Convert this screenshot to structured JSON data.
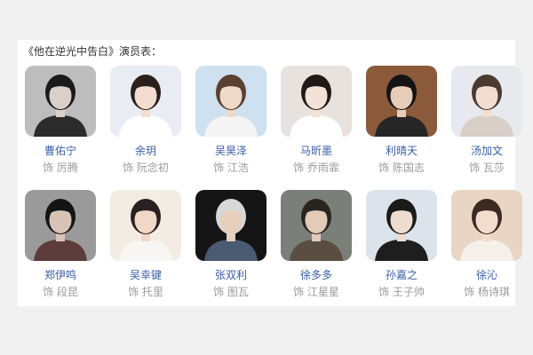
{
  "header": {
    "title": "《他在逆光中告白》演员表："
  },
  "cast": [
    {
      "actor": "曹佑宁",
      "role": "饰 厉腾",
      "bg": "#bdbdbd",
      "shirt": "#2b2b2b",
      "hair": "#1a1a1a",
      "skin": "#d9d0ca"
    },
    {
      "actor": "余玥",
      "role": "饰 阮念初",
      "bg": "#e9edf3",
      "shirt": "#ffffff",
      "hair": "#2a1f1a",
      "skin": "#f2ddd0"
    },
    {
      "actor": "吴昊泽",
      "role": "饰 江浩",
      "bg": "#cfe0ef",
      "shirt": "#f4f4f4",
      "hair": "#5a4030",
      "skin": "#efd9c9"
    },
    {
      "actor": "马昕墨",
      "role": "饰 乔雨霏",
      "bg": "#e8e2df",
      "shirt": "#ffffff",
      "hair": "#1e1a18",
      "skin": "#f3e2d8"
    },
    {
      "actor": "利晴天",
      "role": "饰 陈国志",
      "bg": "#8a5a3a",
      "shirt": "#262626",
      "hair": "#141414",
      "skin": "#e7cdb8"
    },
    {
      "actor": "汤加文",
      "role": "饰 瓦莎",
      "bg": "#e7e9ee",
      "shirt": "#d8cfc8",
      "hair": "#4b3a30",
      "skin": "#f1ddd1"
    },
    {
      "actor": "郑伊鸣",
      "role": "饰 段昆",
      "bg": "#9a9a9a",
      "shirt": "#5c3b3b",
      "hair": "#141414",
      "skin": "#d8c4b6"
    },
    {
      "actor": "吴幸键",
      "role": "饰 托里",
      "bg": "#f3ece5",
      "shirt": "#f8f6f2",
      "hair": "#2a2020",
      "skin": "#f0d8c6"
    },
    {
      "actor": "张双利",
      "role": "饰 图瓦",
      "bg": "#151515",
      "shirt": "#4a5a70",
      "hair": "#d8d8d8",
      "skin": "#e6cfbd"
    },
    {
      "actor": "徐多多",
      "role": "饰 江星星",
      "bg": "#7b7f79",
      "shirt": "#5a4e42",
      "hair": "#2a2420",
      "skin": "#e2cbb8"
    },
    {
      "actor": "孙嘉之",
      "role": "饰 王子帅",
      "bg": "#dde3ea",
      "shirt": "#1e1e1e",
      "hair": "#1a1a1a",
      "skin": "#efdcd0"
    },
    {
      "actor": "徐沁",
      "role": "饰 杨诗琪",
      "bg": "#e8d5c3",
      "shirt": "#f6f0ea",
      "hair": "#3b2a22",
      "skin": "#f2dccd"
    }
  ]
}
